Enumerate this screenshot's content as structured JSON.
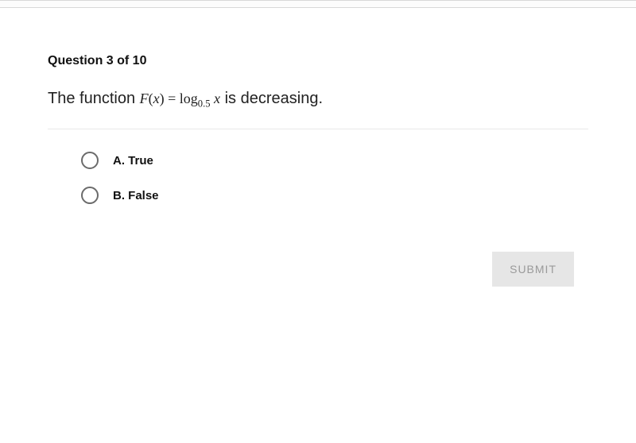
{
  "question": {
    "header": "Question 3 of 10",
    "prefix": "The function ",
    "formula_fn": "F",
    "formula_arg_open": "(",
    "formula_var1": "x",
    "formula_arg_close": ")",
    "formula_eq": " = ",
    "formula_log": "log",
    "formula_base": "0.5",
    "formula_sp": " ",
    "formula_var2": "x",
    "suffix": " is decreasing."
  },
  "options": [
    {
      "letter": "A.",
      "text": "True"
    },
    {
      "letter": "B.",
      "text": "False"
    }
  ],
  "submit_label": "SUBMIT"
}
